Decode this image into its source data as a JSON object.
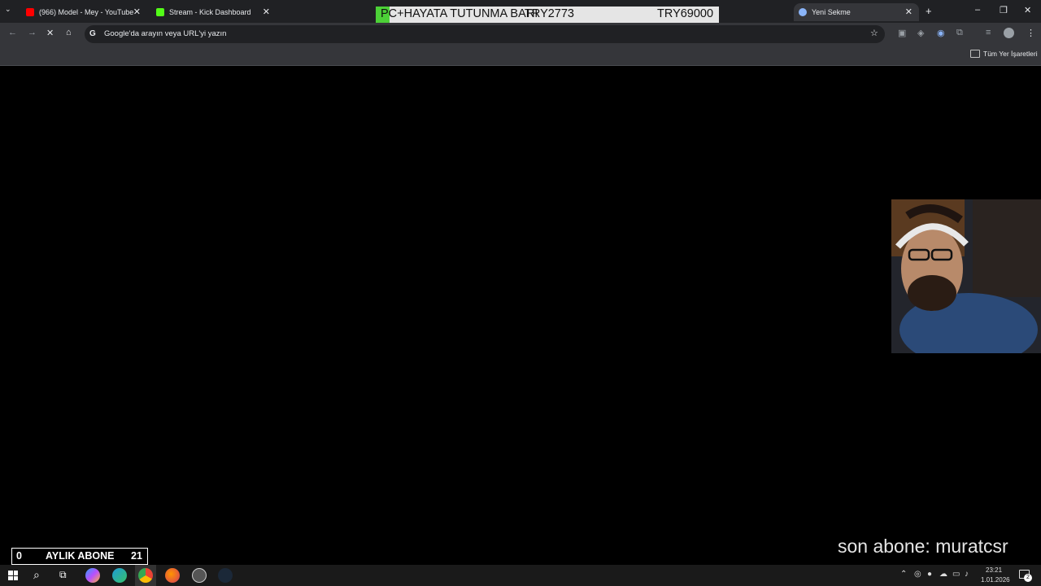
{
  "tabs": [
    {
      "title": "(966) Model - Mey - YouTube",
      "close": "✕"
    },
    {
      "title": "Stream - Kick Dashboard",
      "close": "✕"
    },
    {
      "title": "Yeni Sekme",
      "close": "✕"
    }
  ],
  "new_tab": "+",
  "window_controls": {
    "minimize": "–",
    "maximize": "❐",
    "close": "✕"
  },
  "omnibox": {
    "placeholder": "Google'da arayın veya URL'yi yazın"
  },
  "bookmarks": {
    "all_bookmarks": "Tüm Yer İşaretleri"
  },
  "donation": {
    "title": "PC+HAYATA TUTUNMA BARI",
    "current": "TRY2773",
    "goal": "TRY69000",
    "progress": 0.04
  },
  "subscriber_counter": {
    "left_value": "0",
    "label": "AYLIK ABONE",
    "right_value": "21"
  },
  "last_subscriber": "son abone: muratcsr",
  "clock": {
    "time": "23:21",
    "date": "1.01.2026"
  },
  "notification_count": "2",
  "colors": {
    "chrome_dark": "#202124",
    "chrome_toolbar": "#35363a",
    "progress": "#4cd137"
  }
}
